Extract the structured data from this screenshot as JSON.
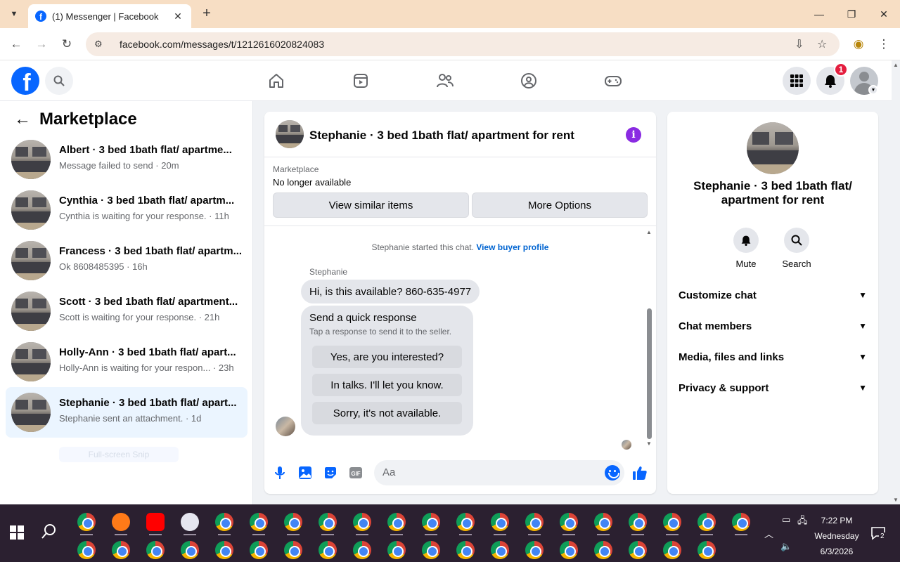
{
  "browser": {
    "tab_title": "(1) Messenger | Facebook",
    "url": "facebook.com/messages/t/1212616020824083"
  },
  "header": {
    "notification_count": "1"
  },
  "sidebar": {
    "title": "Marketplace",
    "conversations": [
      {
        "name": "Albert · 3 bed 1bath flat/ apartme...",
        "subtitle": "Message failed to send · 20m"
      },
      {
        "name": "Cynthia · 3 bed 1bath flat/ apartm...",
        "subtitle": "Cynthia is waiting for your response. · 11h"
      },
      {
        "name": "Francess · 3 bed 1bath flat/ apartm...",
        "subtitle": "Ok 8608485395 · 16h"
      },
      {
        "name": "Scott · 3 bed 1bath flat/ apartment...",
        "subtitle": "Scott is waiting for your response. · 21h"
      },
      {
        "name": "Holly-Ann · 3 bed 1bath flat/ apart...",
        "subtitle": "Holly-Ann is waiting for your respon... · 23h"
      },
      {
        "name": "Stephanie · 3 bed 1bath flat/ apart...",
        "subtitle": "Stephanie sent an attachment. · 1d"
      }
    ],
    "faded_label": "Full-screen Snip"
  },
  "chat": {
    "title": "Stephanie · 3 bed 1bath flat/ apartment for rent",
    "marketplace_label": "Marketplace",
    "listing_status": "No longer available",
    "view_similar_label": "View similar items",
    "more_options_label": "More Options",
    "started_text": "Stephanie started this chat.",
    "view_buyer_profile": "View buyer profile",
    "sender_name": "Stephanie",
    "message_text": "Hi, is this available? 860-635-4977",
    "quick_response_title": "Send a quick response",
    "quick_response_subtitle": "Tap a response to send it to the seller.",
    "quick_responses": [
      "Yes, are you interested?",
      "In talks. I'll let you know.",
      "Sorry, it's not available."
    ],
    "input_placeholder": "Aa"
  },
  "info_panel": {
    "name": "Stephanie · 3 bed 1bath flat/ apartment for rent",
    "mute_label": "Mute",
    "search_label": "Search",
    "sections": [
      "Customize chat",
      "Chat members",
      "Media, files and links",
      "Privacy & support"
    ]
  },
  "taskbar": {
    "time": "7:22 PM",
    "day": "Wednesday",
    "date": "6/3/2026",
    "chat_badge": "2"
  }
}
